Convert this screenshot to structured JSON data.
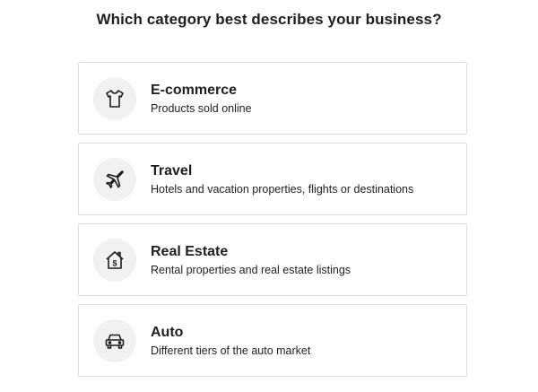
{
  "heading": "Which category best describes your business?",
  "options": [
    {
      "title": "E-commerce",
      "description": "Products sold online",
      "icon": "tshirt-icon"
    },
    {
      "title": "Travel",
      "description": "Hotels and vacation properties, flights or destinations",
      "icon": "airplane-icon"
    },
    {
      "title": "Real Estate",
      "description": "Rental properties and real estate listings",
      "icon": "house-dollar-icon"
    },
    {
      "title": "Auto",
      "description": "Different tiers of the auto market",
      "icon": "car-icon"
    }
  ]
}
